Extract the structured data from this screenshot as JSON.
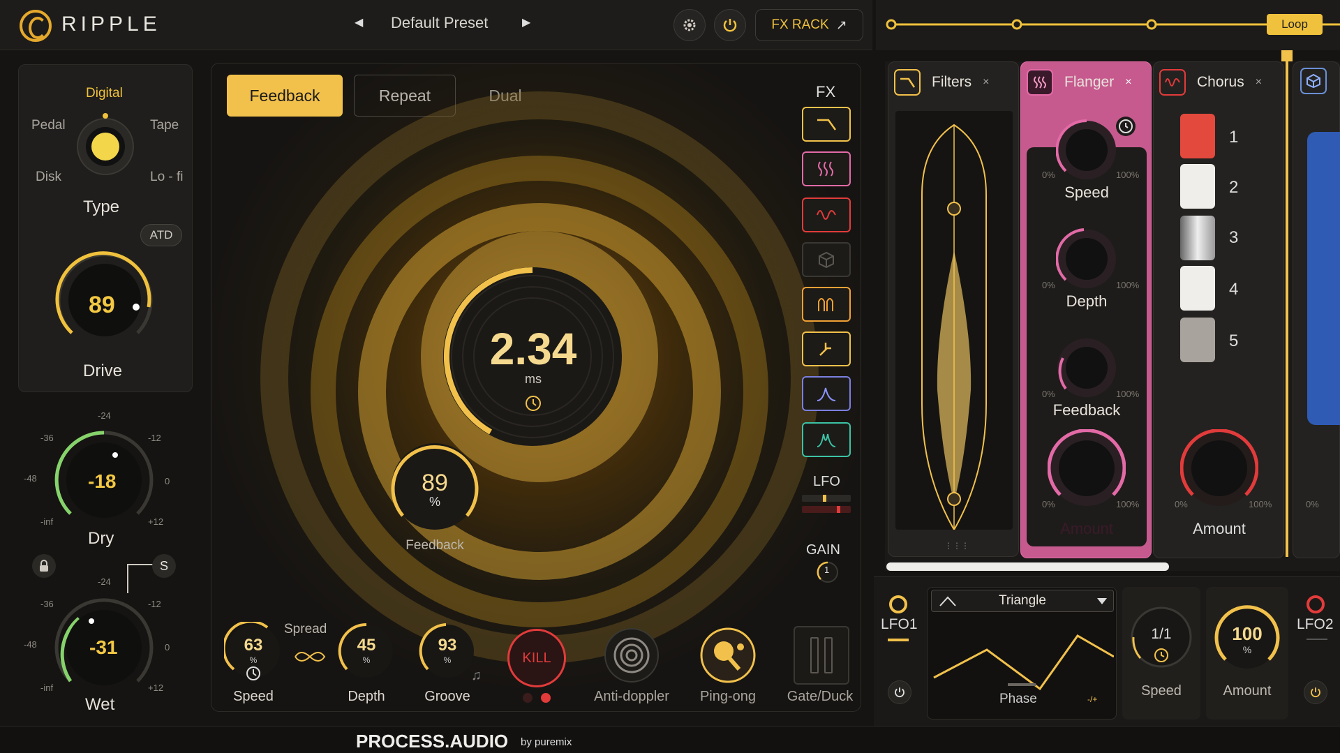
{
  "header": {
    "app_name": "RIPPLE",
    "preset_name": "Default Preset",
    "prev_arrow": "◀",
    "next_arrow": "▶",
    "fx_rack_label": "FX RACK",
    "fx_rack_icon": "↗"
  },
  "sequencer": {
    "loop_label": "Loop"
  },
  "type_panel": {
    "selected": "Digital",
    "options": [
      "Digital",
      "Pedal",
      "Tape",
      "Disk",
      "Lo - fi"
    ],
    "label": "Type",
    "atd_label": "ATD"
  },
  "drive": {
    "value": "89",
    "label": "Drive"
  },
  "dry": {
    "value": "-18",
    "label": "Dry",
    "ticks": [
      "-24",
      "-36",
      "-12",
      "-48",
      "0",
      "-inf",
      "+12"
    ]
  },
  "wet": {
    "value": "-31",
    "label": "Wet",
    "ticks": [
      "-24",
      "-36",
      "-12",
      "-48",
      "0",
      "-inf",
      "+12"
    ]
  },
  "solo_label": "S",
  "center": {
    "tabs": [
      "Feedback",
      "Repeat",
      "Dual"
    ],
    "active_tab": "Feedback",
    "fx_label": "FX",
    "time_value": "2.34",
    "time_unit": "ms",
    "feedback_value": "89",
    "feedback_unit": "%",
    "feedback_label": "Feedback",
    "lfo_label": "LFO",
    "gain_label": "GAIN",
    "gain_value": "1",
    "spread_label": "Spread",
    "bottom_controls": [
      {
        "value": "63",
        "unit": "%",
        "label": "Speed"
      },
      {
        "value": "45",
        "unit": "%",
        "label": "Depth"
      },
      {
        "value": "93",
        "unit": "%",
        "label": "Groove"
      }
    ],
    "kill_label": "KILL",
    "anti_doppler_label": "Anti-doppler",
    "ping_pong_label": "Ping-ong",
    "gate_duck_label": "Gate/Duck",
    "colors": {
      "accent": "#f2c14b",
      "kill": "#e23b3b"
    }
  },
  "fx_rack": {
    "filters": {
      "title": "Filters",
      "close": "×"
    },
    "flanger": {
      "title": "Flanger",
      "close": "×",
      "knobs": [
        {
          "label": "Speed",
          "min": "0%",
          "max": "100%"
        },
        {
          "label": "Depth",
          "min": "0%",
          "max": "100%"
        },
        {
          "label": "Feedback",
          "min": "0%",
          "max": "100%"
        },
        {
          "label": "Amount",
          "min": "0%",
          "max": "100%"
        }
      ],
      "color": "#e36aa7"
    },
    "chorus": {
      "title": "Chorus",
      "close": "×",
      "voices": [
        "1",
        "2",
        "3",
        "4",
        "5"
      ],
      "amount_label": "Amount",
      "min": "0%",
      "max": "100%",
      "color": "#e23b3b"
    },
    "partial_min": "0%"
  },
  "lfo": {
    "lfo1_label": "LFO1",
    "lfo2_label": "LFO2",
    "waveform": "Triangle",
    "phase_label": "Phase",
    "phase_sign": "-/+",
    "speed_value": "1/1",
    "speed_label": "Speed",
    "amount_value": "100",
    "amount_unit": "%",
    "amount_label": "Amount"
  },
  "footer": {
    "brand": "PROCESS.AUDIO",
    "by": "by puremix"
  }
}
